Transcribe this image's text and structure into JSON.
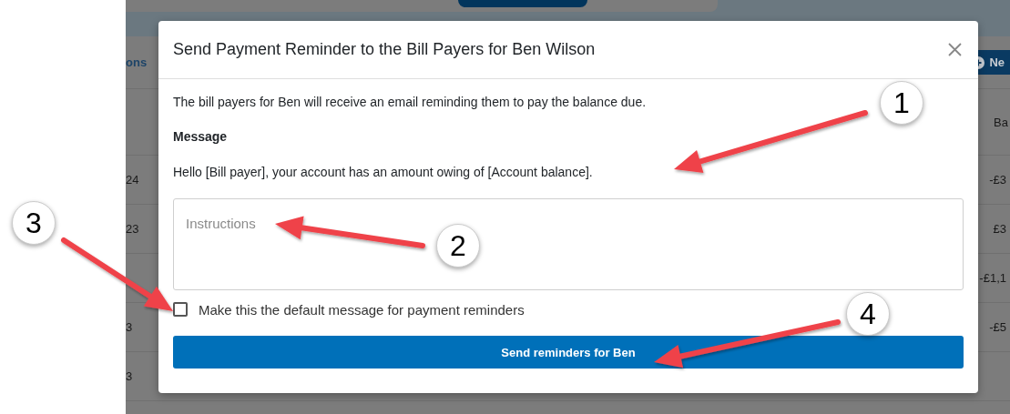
{
  "background_page": {
    "tab_link": "ons",
    "new_button": "Ne",
    "table": {
      "header_balance": "Ba",
      "rows": [
        {
          "column_1": "24",
          "balance": "-£3"
        },
        {
          "column_1": "23",
          "balance": "£3"
        },
        {
          "balance": "-£1,1"
        },
        {
          "column_1": "3",
          "balance": "-£5"
        },
        {
          "column_1": "3"
        }
      ]
    }
  },
  "modal": {
    "title": "Send Payment Reminder to the Bill Payers for Ben Wilson",
    "description": "The bill payers for Ben will receive an email reminding them to pay the balance due.",
    "message_label": "Message",
    "message_text": "Hello [Bill payer], your account has an amount owing of [Account balance].",
    "instructions": {
      "placeholder": "Instructions"
    },
    "default_checkbox": {
      "label": "Make this the default message for payment reminders",
      "checked": false
    },
    "send_button": "Send reminders for Ben"
  },
  "callouts": [
    {
      "label": "1"
    },
    {
      "label": "2"
    },
    {
      "label": "3"
    },
    {
      "label": "4"
    }
  ]
}
